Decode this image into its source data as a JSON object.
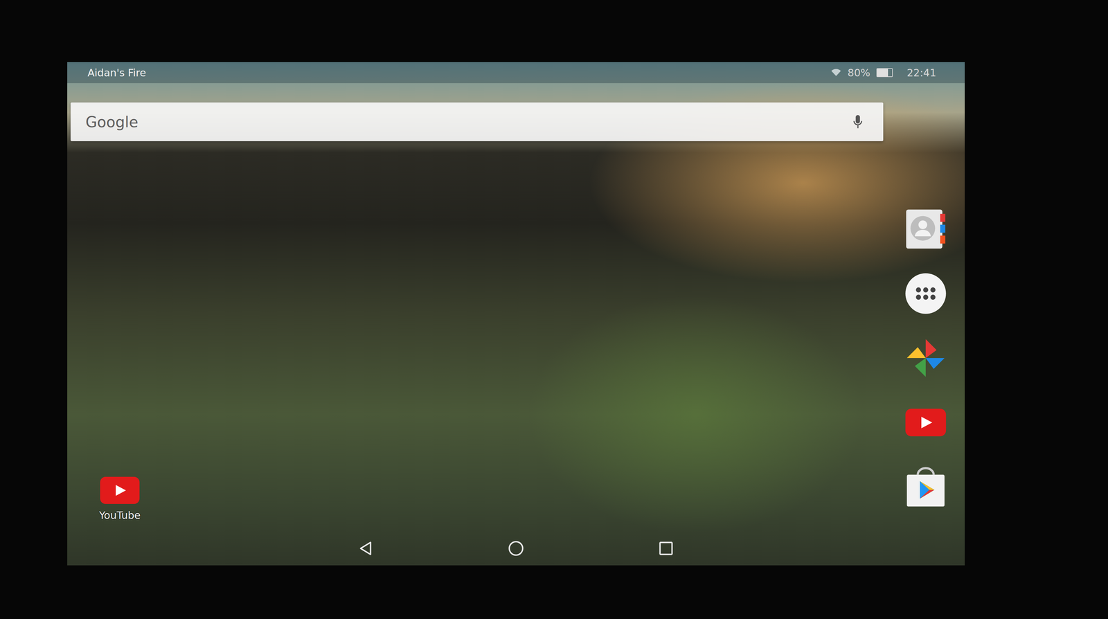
{
  "device": {
    "name": "Aidan's Fire"
  },
  "status_bar": {
    "wifi_connected": true,
    "battery": "80%",
    "battery_level": 0.8,
    "time": "22:41"
  },
  "search": {
    "placeholder": "Google"
  },
  "desktop_apps": [
    {
      "label": "YouTube",
      "kind": "youtube"
    }
  ],
  "dock": [
    {
      "kind": "contacts"
    },
    {
      "kind": "apps"
    },
    {
      "kind": "photos"
    },
    {
      "kind": "youtube"
    },
    {
      "kind": "play-store"
    }
  ],
  "nav": [
    {
      "kind": "back"
    },
    {
      "kind": "home"
    },
    {
      "kind": "recent"
    }
  ]
}
